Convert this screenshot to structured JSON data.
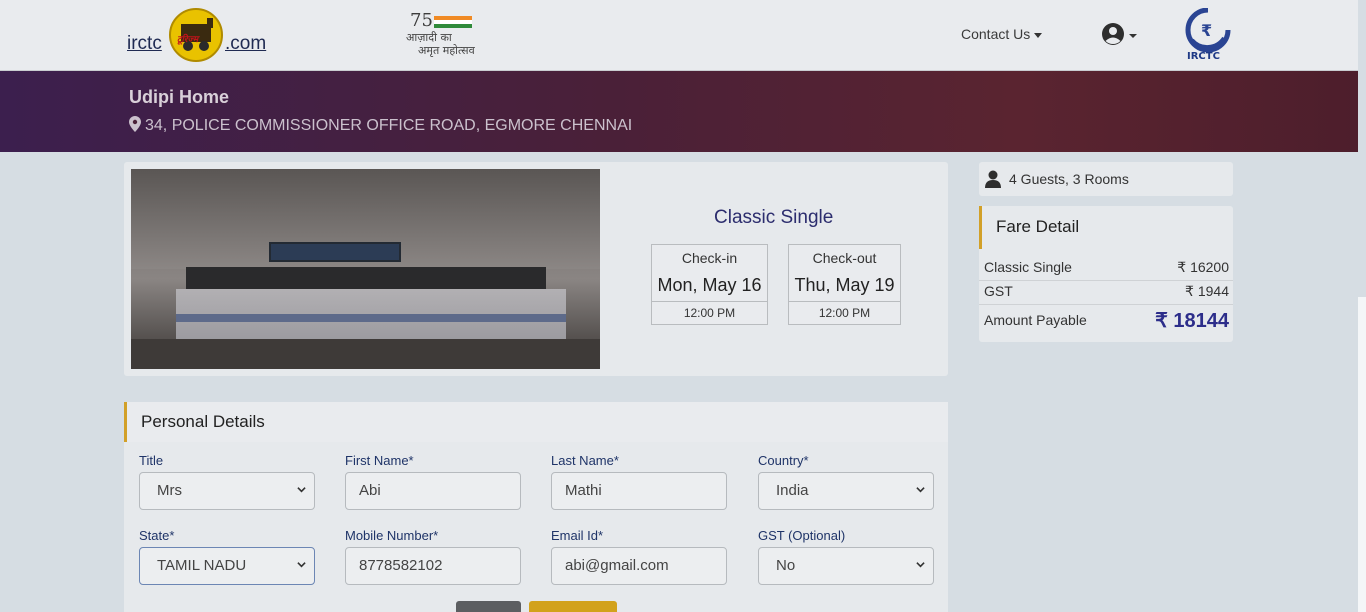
{
  "header": {
    "logo_left": "irctc",
    "logo_right": ".com",
    "logo_tag": "टूरिज्म",
    "azadi_number": "75",
    "azadi_line1": "आज़ादी का",
    "azadi_line2": "अमृत महोत्सव",
    "contact_label": "Contact Us",
    "irctc_label": "IRCTC"
  },
  "hotel": {
    "name": "Udipi Home",
    "address": "34, POLICE COMMISSIONER OFFICE ROAD, EGMORE CHENNAI"
  },
  "room": {
    "name": "Classic Single",
    "checkin_label": "Check-in",
    "checkin_date": "Mon, May 16",
    "checkin_time": "12:00 PM",
    "checkout_label": "Check-out",
    "checkout_date": "Thu, May 19",
    "checkout_time": "12:00 PM"
  },
  "guests": "4 Guests, 3 Rooms",
  "fare": {
    "title": "Fare Detail",
    "rows": [
      {
        "label": "Classic Single",
        "value": "₹ 16200"
      },
      {
        "label": "GST",
        "value": "₹ 1944"
      }
    ],
    "total_label": "Amount Payable",
    "total_value": "₹ 18144"
  },
  "personal": {
    "title": "Personal Details",
    "fields": {
      "title": {
        "label": "Title",
        "value": "Mrs"
      },
      "first_name": {
        "label": "First Name*",
        "value": "Abi"
      },
      "last_name": {
        "label": "Last Name*",
        "value": "Mathi"
      },
      "country": {
        "label": "Country*",
        "value": "India"
      },
      "state": {
        "label": "State*",
        "value": "TAMIL NADU"
      },
      "mobile": {
        "label": "Mobile Number*",
        "value": "8778582102"
      },
      "email": {
        "label": "Email Id*",
        "value": "abi@gmail.com"
      },
      "gst": {
        "label": "GST (Optional)",
        "value": "No"
      }
    }
  },
  "colors": {
    "banner_start": "#3c1f4e",
    "banner_end": "#5a2430",
    "accent": "#d2a028",
    "price": "#2c2d8a"
  }
}
